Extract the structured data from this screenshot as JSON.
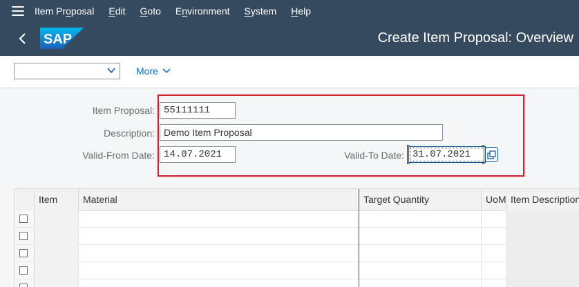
{
  "menu": {
    "items": [
      {
        "label": "Item Proposal",
        "underline_index": 7
      },
      {
        "label": "Edit",
        "underline_index": 0
      },
      {
        "label": "Goto",
        "underline_index": 0
      },
      {
        "label": "Environment",
        "underline_index": 1
      },
      {
        "label": "System",
        "underline_index": 0
      },
      {
        "label": "Help",
        "underline_index": 0
      }
    ]
  },
  "header": {
    "logo_text": "SAP",
    "title": "Create Item Proposal: Overview"
  },
  "toolbar": {
    "dropdown_value": "",
    "more_label": "More"
  },
  "form": {
    "item_proposal_label": "Item Proposal:",
    "item_proposal_value": "55111111",
    "description_label": "Description:",
    "description_value": "Demo Item Proposal",
    "valid_from_label": "Valid-From Date:",
    "valid_from_value": "14.07.2021",
    "valid_to_label": "Valid-To Date:",
    "valid_to_value": "31.07.2021"
  },
  "table": {
    "columns": [
      "Item",
      "Material",
      "Target Quantity",
      "UoM",
      "Item Description"
    ],
    "rows": [
      [
        "",
        "",
        "",
        "",
        ""
      ],
      [
        "",
        "",
        "",
        "",
        ""
      ],
      [
        "",
        "",
        "",
        "",
        ""
      ],
      [
        "",
        "",
        "",
        "",
        ""
      ],
      [
        "",
        "",
        "",
        "",
        ""
      ]
    ]
  },
  "colors": {
    "shell": "#354a5f",
    "accent": "#0a6ed1",
    "highlight": "#d0202d",
    "sap_blue": "#0a6ed1"
  }
}
